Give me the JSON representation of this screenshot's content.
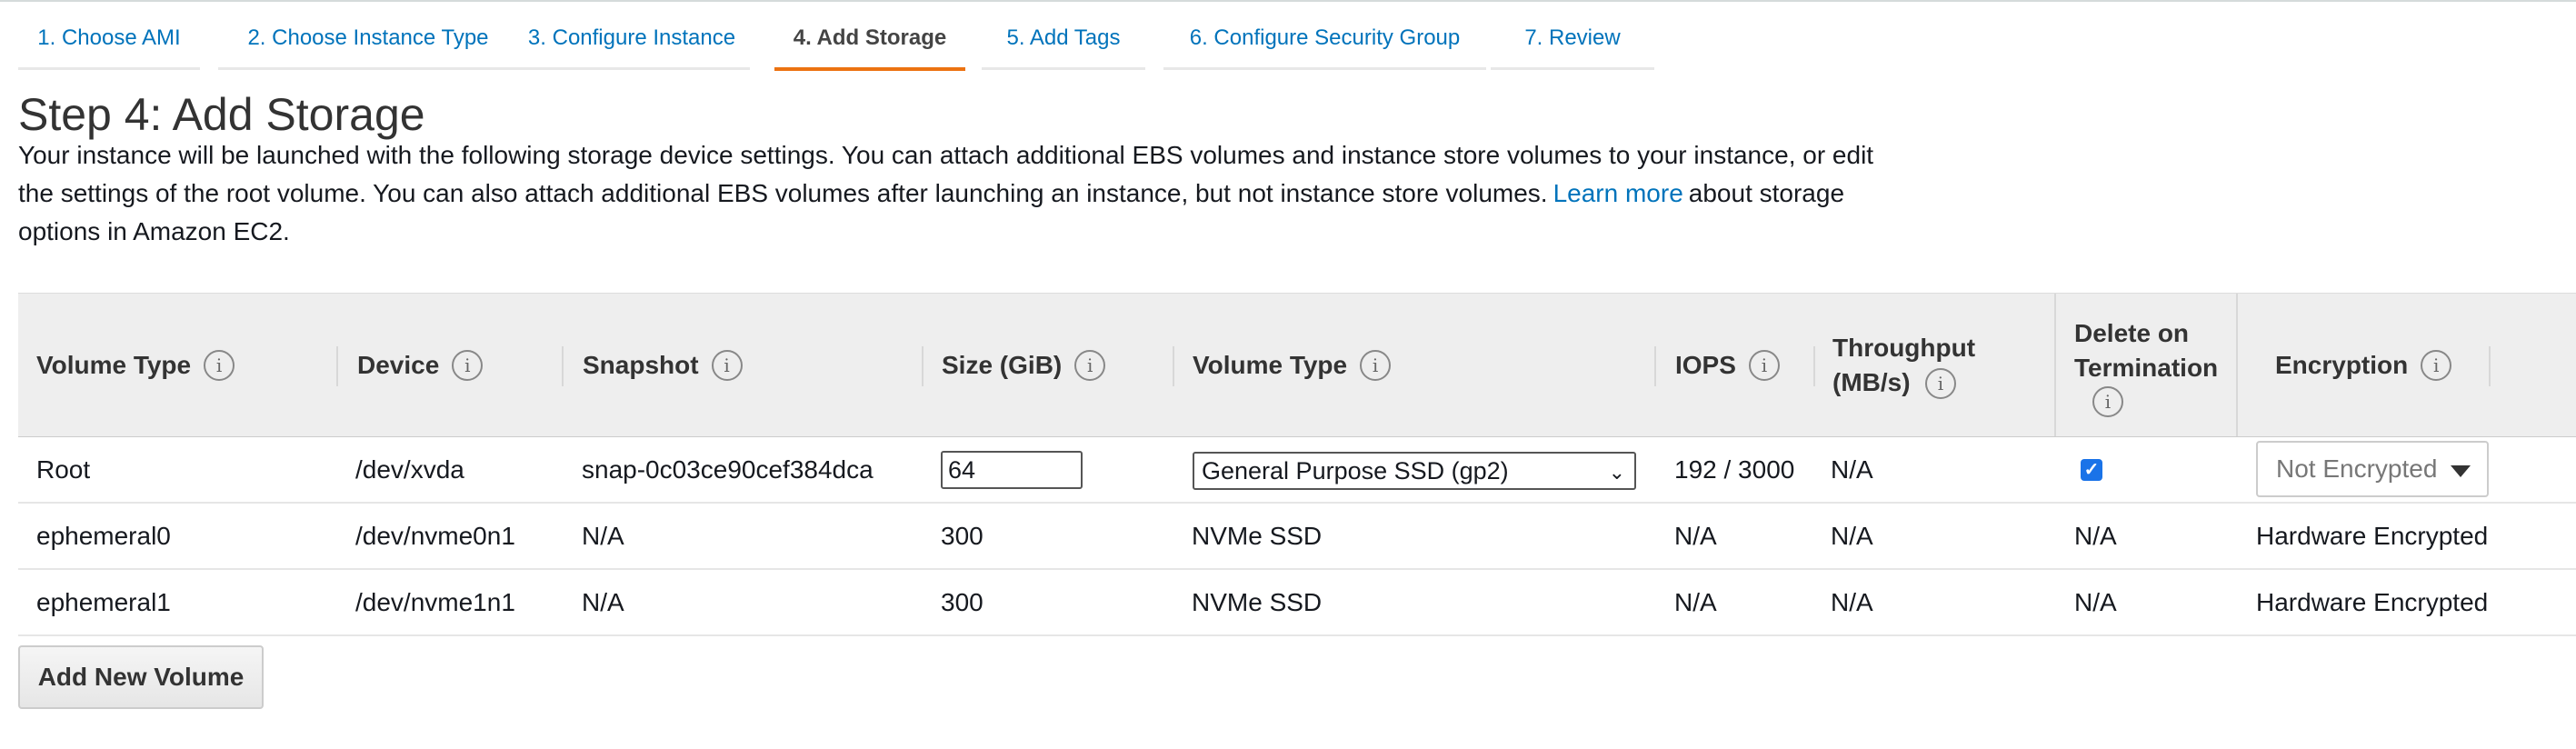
{
  "tabs": [
    {
      "label": "1. Choose AMI"
    },
    {
      "label": "2. Choose Instance Type"
    },
    {
      "label": "3. Configure Instance"
    },
    {
      "label": "4. Add Storage"
    },
    {
      "label": "5. Add Tags"
    },
    {
      "label": "6. Configure Security Group"
    },
    {
      "label": "7. Review"
    }
  ],
  "active_tab": "4. Add Storage",
  "page": {
    "title": "Step 4: Add Storage",
    "description_before_link": "Your instance will be launched with the following storage device settings. You can attach additional EBS volumes and instance store volumes to your instance, or edit the settings of the root volume. You can also attach additional EBS volumes after launching an instance, but not instance store volumes.",
    "learn_more_link": "Learn more",
    "description_after_link": "about storage options in Amazon EC2."
  },
  "table": {
    "headers": {
      "volume_type": "Volume Type",
      "device": "Device",
      "snapshot": "Snapshot",
      "size": "Size (GiB)",
      "volume_type2": "Volume Type",
      "iops": "IOPS",
      "throughput": "Throughput (MB/s)",
      "delete_on_termination": "Delete on Termination",
      "encryption": "Encryption"
    },
    "info_glyph": "i",
    "root": {
      "volume_type": "Root",
      "device": "/dev/xvda",
      "snapshot": "snap-0c03ce90cef384dca",
      "size_value": "64",
      "volume_type_selected": "General Purpose SSD (gp2)",
      "iops": "192 / 3000",
      "throughput": "N/A",
      "delete_on_termination_checked": true,
      "encryption_selected": "Not Encrypted"
    },
    "ephemeral": [
      {
        "volume_type": "ephemeral0",
        "device": "/dev/nvme0n1",
        "snapshot": "N/A",
        "size": "300",
        "volume_type2": "NVMe SSD",
        "iops": "N/A",
        "throughput": "N/A",
        "delete": "N/A",
        "encryption": "Hardware Encrypted"
      },
      {
        "volume_type": "ephemeral1",
        "device": "/dev/nvme1n1",
        "snapshot": "N/A",
        "size": "300",
        "volume_type2": "NVMe SSD",
        "iops": "N/A",
        "throughput": "N/A",
        "delete": "N/A",
        "encryption": "Hardware Encrypted"
      }
    ]
  },
  "buttons": {
    "add_new_volume": "Add New Volume"
  },
  "colors": {
    "link": "#0073bb",
    "active_tab_underline": "#ec7211",
    "checkbox": "#1a73e8"
  },
  "icons": [
    "info-icon",
    "chevron-down-icon",
    "check-icon",
    "caret-down-icon"
  ]
}
